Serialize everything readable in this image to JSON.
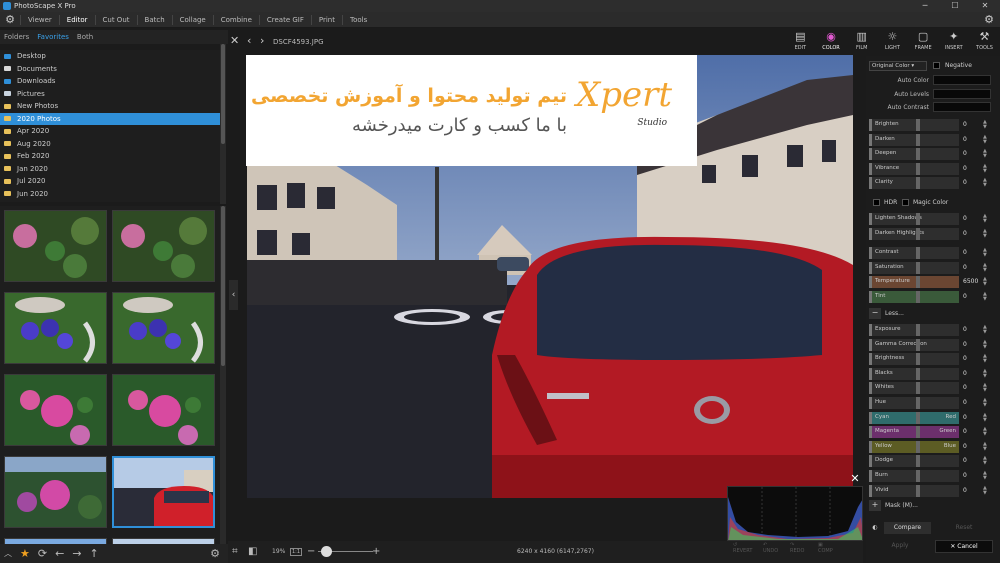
{
  "app": {
    "title": "PhotoScape X Pro"
  },
  "menu": {
    "items": [
      "Viewer",
      "Editor",
      "Cut Out",
      "Batch",
      "Collage",
      "Combine",
      "Create GIF",
      "Print",
      "Tools"
    ],
    "active": "Editor"
  },
  "left_tabs": [
    "Folders",
    "Favorites",
    "Both"
  ],
  "tree": [
    {
      "label": "Desktop",
      "color": "#2f8fd8"
    },
    {
      "label": "Documents",
      "color": "#d8d8d8"
    },
    {
      "label": "Downloads",
      "color": "#2f8fd8"
    },
    {
      "label": "Pictures",
      "color": "#c9d4e0"
    },
    {
      "label": "New Photos",
      "color": "#e8c15a"
    },
    {
      "label": "2020 Photos",
      "color": "#e8c15a",
      "selected": true
    },
    {
      "label": "Apr 2020",
      "color": "#e8c15a"
    },
    {
      "label": "Aug 2020",
      "color": "#e8c15a"
    },
    {
      "label": "Feb 2020",
      "color": "#e8c15a"
    },
    {
      "label": "Jan 2020",
      "color": "#e8c15a"
    },
    {
      "label": "Jul 2020",
      "color": "#e8c15a"
    },
    {
      "label": "Jun 2020",
      "color": "#e8c15a"
    }
  ],
  "viewer": {
    "filename": "DSCF4593.JPG",
    "dimensions": "6240 x 4160 (6147,2767)",
    "zoom": "19%",
    "zoom_fit": "1:1"
  },
  "banner": {
    "line1": "تیم تولید محتوا و آموزش تخصصی",
    "line2": "با ما کسب و کارت میدرخشه",
    "logo": "Xpert",
    "logo_sub": "Studio"
  },
  "tools": [
    {
      "label": "EDIT",
      "icon": "edit-icon"
    },
    {
      "label": "COLOR",
      "icon": "color-wheel-icon",
      "selected": true
    },
    {
      "label": "FILM",
      "icon": "film-icon"
    },
    {
      "label": "LIGHT",
      "icon": "light-icon"
    },
    {
      "label": "FRAME",
      "icon": "frame-icon"
    },
    {
      "label": "INSERT",
      "icon": "insert-icon"
    },
    {
      "label": "TOOLS",
      "icon": "tools-icon"
    }
  ],
  "panel": {
    "preset": "Original Color",
    "negative": "Negative",
    "auto_color": "Auto Color",
    "auto_levels": "Auto Levels",
    "auto_contrast": "Auto Contrast",
    "hdr": "HDR",
    "magic_color": "Magic Color",
    "less": "Less...",
    "mask": "Mask (M)...",
    "compare": "Compare",
    "reset": "Reset",
    "apply": "Apply",
    "cancel": "Cancel",
    "group1": [
      {
        "label": "Brighten",
        "value": "0"
      },
      {
        "label": "Darken",
        "value": "0"
      },
      {
        "label": "Deepen",
        "value": "0"
      },
      {
        "label": "Vibrance",
        "value": "0"
      },
      {
        "label": "Clarity",
        "value": "0"
      }
    ],
    "group2": [
      {
        "label": "Lighten Shadows",
        "value": "0"
      },
      {
        "label": "Darken Highlights",
        "value": "0"
      }
    ],
    "group3": [
      {
        "label": "Contrast",
        "value": "0"
      },
      {
        "label": "Saturation",
        "value": "0"
      },
      {
        "label": "Temperature",
        "value": "6500",
        "color": "#6b4632"
      },
      {
        "label": "Tint",
        "value": "0",
        "color": "#3a5a3a"
      }
    ],
    "group4": [
      {
        "label": "Exposure",
        "value": "0"
      },
      {
        "label": "Gamma Correction",
        "value": "0"
      },
      {
        "label": "Brightness",
        "value": "0"
      },
      {
        "label": "Blacks",
        "value": "0"
      },
      {
        "label": "Whites",
        "value": "0"
      },
      {
        "label": "Hue",
        "value": "0"
      },
      {
        "label": "Cyan",
        "right": "Red",
        "value": "0",
        "color": "#2f6c6c"
      },
      {
        "label": "Magenta",
        "right": "Green",
        "value": "0",
        "color": "#6c2f6c"
      },
      {
        "label": "Yellow",
        "right": "Blue",
        "value": "0",
        "color": "#5c5c24"
      },
      {
        "label": "Dodge",
        "value": "0"
      },
      {
        "label": "Burn",
        "value": "0"
      },
      {
        "label": "Vivid",
        "value": "0"
      }
    ]
  },
  "bottom_actions": [
    "REVERT",
    "UNDO",
    "REDO",
    "COMP",
    "ROTATE",
    "..."
  ]
}
